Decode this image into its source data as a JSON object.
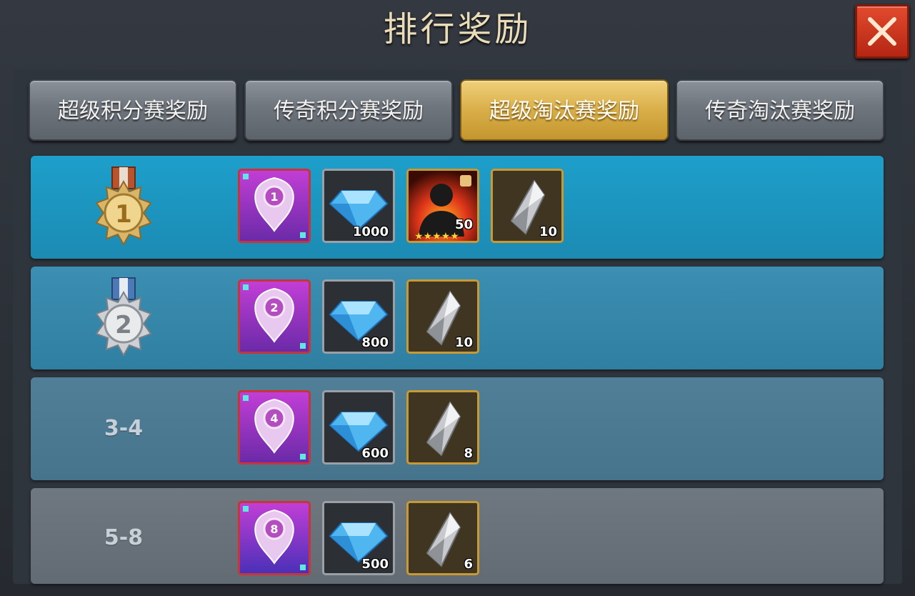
{
  "title": "排行奖励",
  "tabs": [
    {
      "label": "超级积分赛奖励",
      "active": false
    },
    {
      "label": "传奇积分赛奖励",
      "active": false
    },
    {
      "label": "超级淘汰赛奖励",
      "active": true
    },
    {
      "label": "传奇淘汰赛奖励",
      "active": false
    }
  ],
  "colors": {
    "active_tab": "#d9ae48",
    "close_button": "#c93a1f",
    "rank1_row": "#1d9fcb"
  },
  "ranks": [
    {
      "medal": "gold-medal",
      "medal_number": "1",
      "rank": "",
      "badge_number": "1",
      "diamonds": "1000",
      "hero_fragments": "50",
      "hero_stars": 5,
      "crystals": "10"
    },
    {
      "medal": "silver-medal",
      "medal_number": "2",
      "rank": "",
      "badge_number": "2",
      "diamonds": "800",
      "crystals": "10"
    },
    {
      "rank": "3-4",
      "badge_number": "4",
      "diamonds": "600",
      "crystals": "8"
    },
    {
      "rank": "5-8",
      "badge_number": "8",
      "diamonds": "500",
      "crystals": "6"
    }
  ]
}
